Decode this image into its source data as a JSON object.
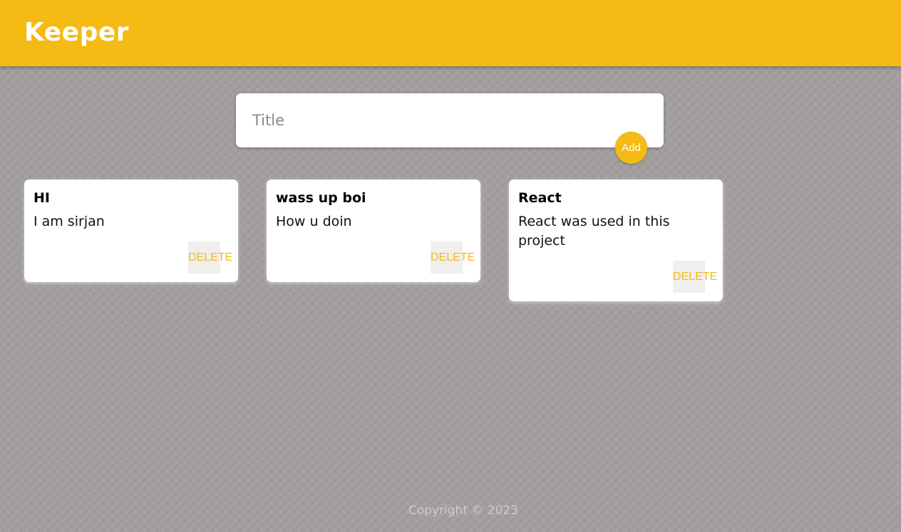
{
  "header": {
    "title": "Keeper"
  },
  "create": {
    "placeholder": "Title",
    "add_label": "Add"
  },
  "notes": [
    {
      "title": "HI",
      "content": "I am sirjan",
      "delete_label": "DELETE"
    },
    {
      "title": "wass up boi",
      "content": "How u doin",
      "delete_label": "DELETE"
    },
    {
      "title": "React",
      "content": "React was used in this project",
      "delete_label": "DELETE"
    }
  ],
  "footer": {
    "text": "Copyright © 2023"
  },
  "colors": {
    "accent": "#f5ba13",
    "background": "#a39f9e",
    "card": "#ffffff",
    "footer_text": "#cccccc"
  }
}
